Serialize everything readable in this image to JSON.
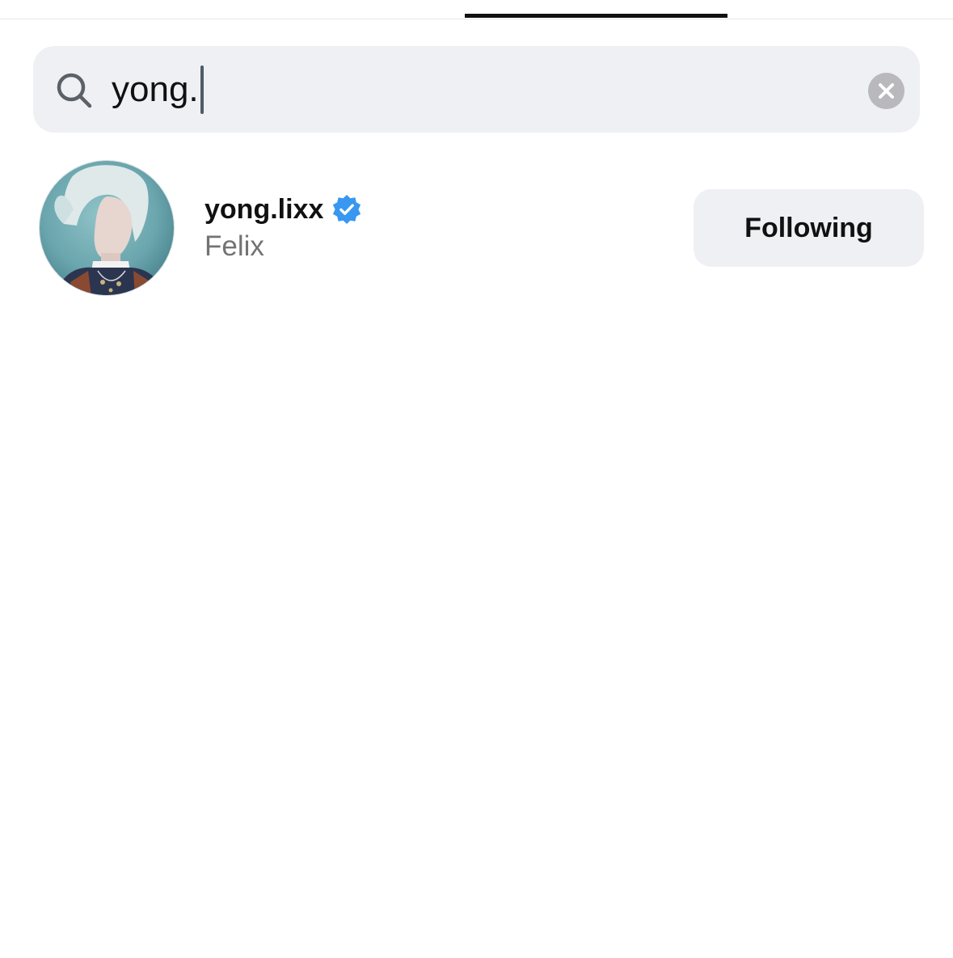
{
  "search": {
    "query": "yong."
  },
  "results": [
    {
      "username": "yong.lixx",
      "display_name": "Felix",
      "verified": true,
      "verified_icon": "verified-badge-icon",
      "follow_label": "Following"
    }
  ],
  "colors": {
    "verified": "#3897f0",
    "search_bg": "#eff0f4",
    "button_bg": "#eff0f4",
    "secondary_text": "#737373",
    "tab_indicator": "#111111"
  }
}
